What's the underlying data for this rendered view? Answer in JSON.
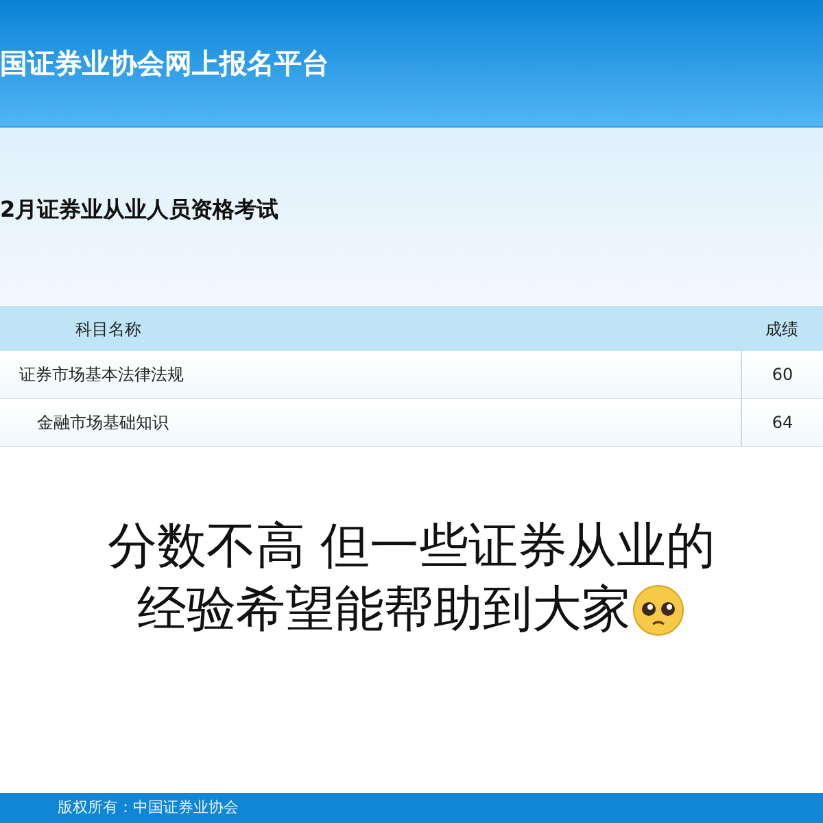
{
  "header": {
    "title": "国证券业协会网上报名平台"
  },
  "exam": {
    "title": "2月证券业从业人员资格考试"
  },
  "table": {
    "columns": [
      "科目名称",
      "成绩"
    ],
    "rows": [
      [
        "证券市场基本法律法规",
        "60"
      ],
      [
        "金融市场基础知识",
        "64"
      ]
    ]
  },
  "caption": {
    "lines": [
      "分数不高 但一些证券从业的",
      "经验希望能帮助到大家"
    ]
  },
  "footer": {
    "text": "版权所有：中国证券业协会"
  }
}
